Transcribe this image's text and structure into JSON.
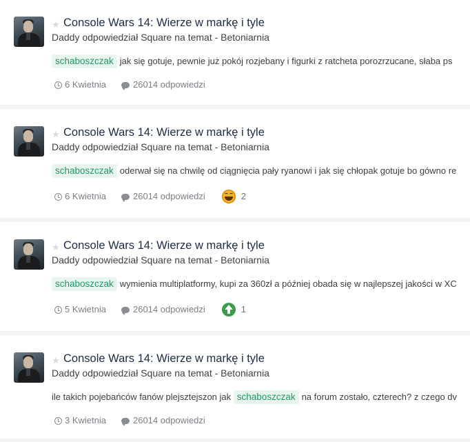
{
  "feed": {
    "items": [
      {
        "title": "Console Wars 14: Wierze w markę i tyle",
        "meta": "Daddy odpowiedział Square na temat - Betoniarnia",
        "tag": "schaboszczak",
        "text_before": "",
        "text_after": "jak się gotuje, pewnie już pokój rozjebany i figurki z ratcheta porozrzucane, słaba ps",
        "date": "6 Kwietnia",
        "replies": "26014 odpowiedzi",
        "reaction_icon": "",
        "reaction_count": ""
      },
      {
        "title": "Console Wars 14: Wierze w markę i tyle",
        "meta": "Daddy odpowiedział Square na temat - Betoniarnia",
        "tag": "schaboszczak",
        "text_before": "",
        "text_after": "oderwał się na chwilę od ciągnięcia pały ryanowi i jak się chłopak gotuje bo gówno re",
        "date": "6 Kwietnia",
        "replies": "26014 odpowiedzi",
        "reaction_icon": "haha-emoji-icon",
        "reaction_count": "2"
      },
      {
        "title": "Console Wars 14: Wierze w markę i tyle",
        "meta": "Daddy odpowiedział Square na temat - Betoniarnia",
        "tag": "schaboszczak",
        "text_before": "",
        "text_after": "wymienia multiplatformy, kupi za 360zł a później obada się w najlepszej jakości w XC",
        "date": "5 Kwietnia",
        "replies": "26014 odpowiedzi",
        "reaction_icon": "upvote-icon",
        "reaction_count": "1"
      },
      {
        "title": "Console Wars 14: Wierze w markę i tyle",
        "meta": "Daddy odpowiedział Square na temat - Betoniarnia",
        "tag": "schaboszczak",
        "text_before": "ile takich pojebańców fanów plejsztejszon jak",
        "text_after": "na forum zostało, czterech? z czego dv",
        "date": "3 Kwietnia",
        "replies": "26014 odpowiedzi",
        "reaction_icon": "",
        "reaction_count": ""
      }
    ]
  },
  "colors": {
    "title": "#1d2c46",
    "tag_bg": "#e8f6ef",
    "tag_text": "#1f9a61",
    "muted": "#7b7f85",
    "upvote": "#3d9b4a",
    "haha": "#f7b422"
  }
}
